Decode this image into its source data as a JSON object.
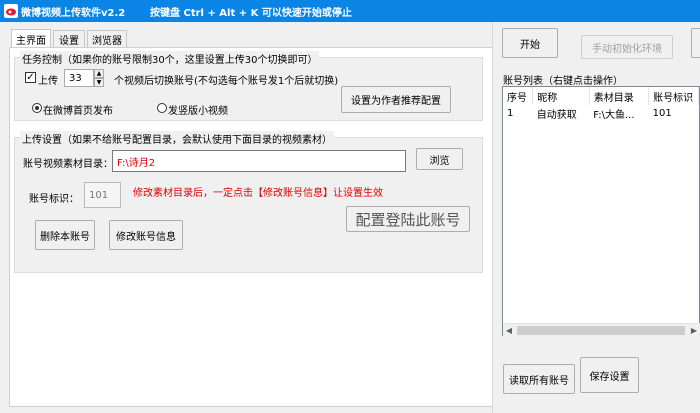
{
  "window": {
    "title": "微博视频上传软件v2.2",
    "hint": "按键盘 Ctrl + Alt + K  可以快速开始或停止"
  },
  "tabs": [
    {
      "label": "主界面",
      "active": true
    },
    {
      "label": "设置",
      "active": false
    },
    {
      "label": "浏览器",
      "active": false
    }
  ],
  "task_control": {
    "title": "任务控制（如果你的账号限制30个，这里设置上传30个切换即可）",
    "upload_checkbox_label": "上传",
    "upload_checked": true,
    "upload_count": "33",
    "switch_text": "个视频后切换账号(不勾选每个账号发1个后就切换)",
    "radio_weibo": "在微博首页发布",
    "radio_vertical": "发竖版小视频",
    "radio_selected": "weibo",
    "recommend_button": "设置为作者推荐配置"
  },
  "upload_settings": {
    "title": "上传设置（如果不给账号配置目录，会默认使用下面目录的视频素材）",
    "dir_label": "账号视频素材目录：",
    "dir_value": "F:\\诗月2",
    "browse_button": "浏览",
    "account_id_label": "账号标识：",
    "account_id_value": "101",
    "warning": "修改素材目录后，一定点击【修改账号信息】让设置生效",
    "config_login_button": "配置登陆此账号",
    "delete_button": "删除本账号",
    "modify_button": "修改账号信息"
  },
  "right_panel": {
    "start_button": "开始",
    "init_button": "手动初始化环境",
    "list_title": "账号列表（右键点击操作）",
    "columns": [
      "序号",
      "昵称",
      "素材目录",
      "账号标识"
    ],
    "rows": [
      [
        "1",
        "自动获取",
        "F:\\大鱼...",
        "101"
      ]
    ],
    "read_all_button": "读取所有账号",
    "save_button": "保存设置"
  },
  "colors": {
    "titlebar": "#0a85e6",
    "warning": "#e00000"
  }
}
